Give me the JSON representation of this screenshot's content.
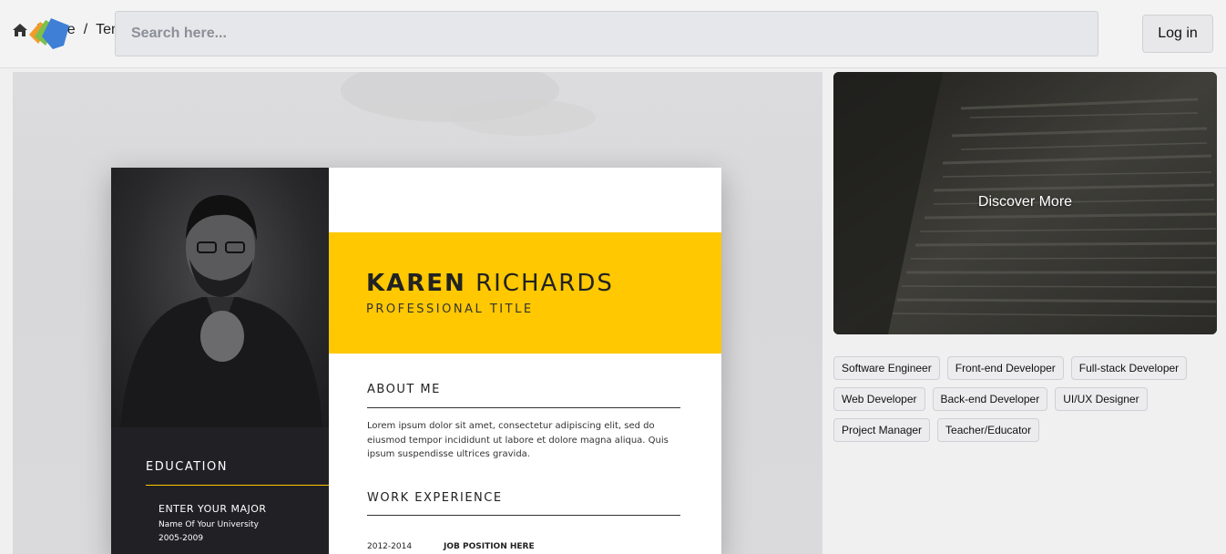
{
  "header": {
    "breadcrumb": [
      "Home",
      "Tem"
    ],
    "breadcrumb_separator": "/",
    "search_placeholder": "Search here...",
    "login_label": "Log in"
  },
  "resume": {
    "first_name": "KAREN",
    "last_name": "RICHARDS",
    "professional_title": "PROFESSIONAL TITLE",
    "about_heading": "ABOUT ME",
    "about_text": "Lorem ipsum dolor sit amet, consectetur adipiscing elit, sed do eiusmod tempor incididunt ut labore et dolore magna aliqua. Quis ipsum suspendisse ultrices gravida.",
    "work_heading": "WORK EXPERIENCE",
    "work_years": "2012-2014",
    "work_position": "JOB POSITION HERE",
    "education_heading": "EDUCATION",
    "education_major": "ENTER YOUR MAJOR",
    "education_university": "Name Of Your University",
    "education_years": "2005-2009",
    "accent_color": "#ffc800",
    "sidebar_color": "#212024"
  },
  "discover": {
    "label": "Discover More"
  },
  "tags": [
    "Software Engineer",
    "Front-end Developer",
    "Full-stack Developer",
    "Web Developer",
    "Back-end Developer",
    "UI/UX Designer",
    "Project Manager",
    "Teacher/Educator"
  ],
  "icons": {
    "home": "home-icon",
    "logo": "app-logo"
  }
}
